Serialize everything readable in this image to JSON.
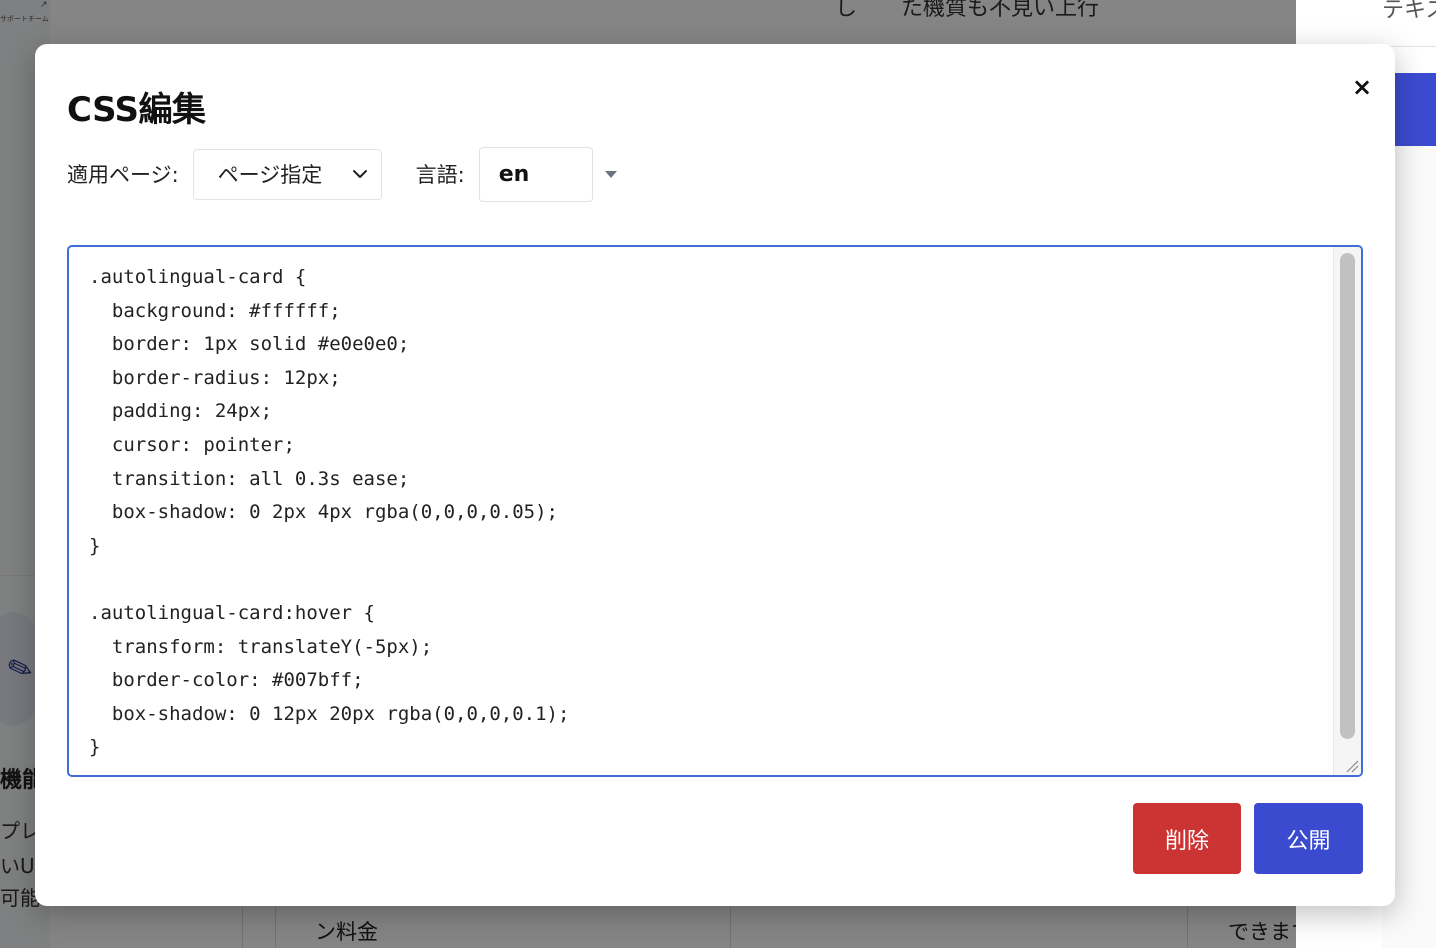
{
  "background": {
    "support_text": "サポートチーム",
    "top_text": "し　　た機質も不見い上行",
    "left_title": "機能",
    "left_lines": [
      "プレ",
      "いUI",
      "可能"
    ],
    "bottom_left": "ン料金",
    "bottom_right": "できます",
    "side_panel_text": "テキスト"
  },
  "modal": {
    "title": "CSS編集",
    "close_label": "×",
    "page_label": "適用ページ:",
    "page_select_value": "ページ指定",
    "language_label": "言語:",
    "language_value": "en",
    "css_code": ".autolingual-card {\n  background: #ffffff;\n  border: 1px solid #e0e0e0;\n  border-radius: 12px;\n  padding: 24px;\n  cursor: pointer;\n  transition: all 0.3s ease;\n  box-shadow: 0 2px 4px rgba(0,0,0,0.05);\n}\n\n.autolingual-card:hover {\n  transform: translateY(-5px);\n  border-color: #007bff;\n  box-shadow: 0 12px 20px rgba(0,0,0,0.1);\n}",
    "delete_label": "削除",
    "publish_label": "公開"
  },
  "colors": {
    "delete": "#cc3433",
    "publish": "#3b4bd0",
    "editor_border": "#3f6fd6"
  }
}
